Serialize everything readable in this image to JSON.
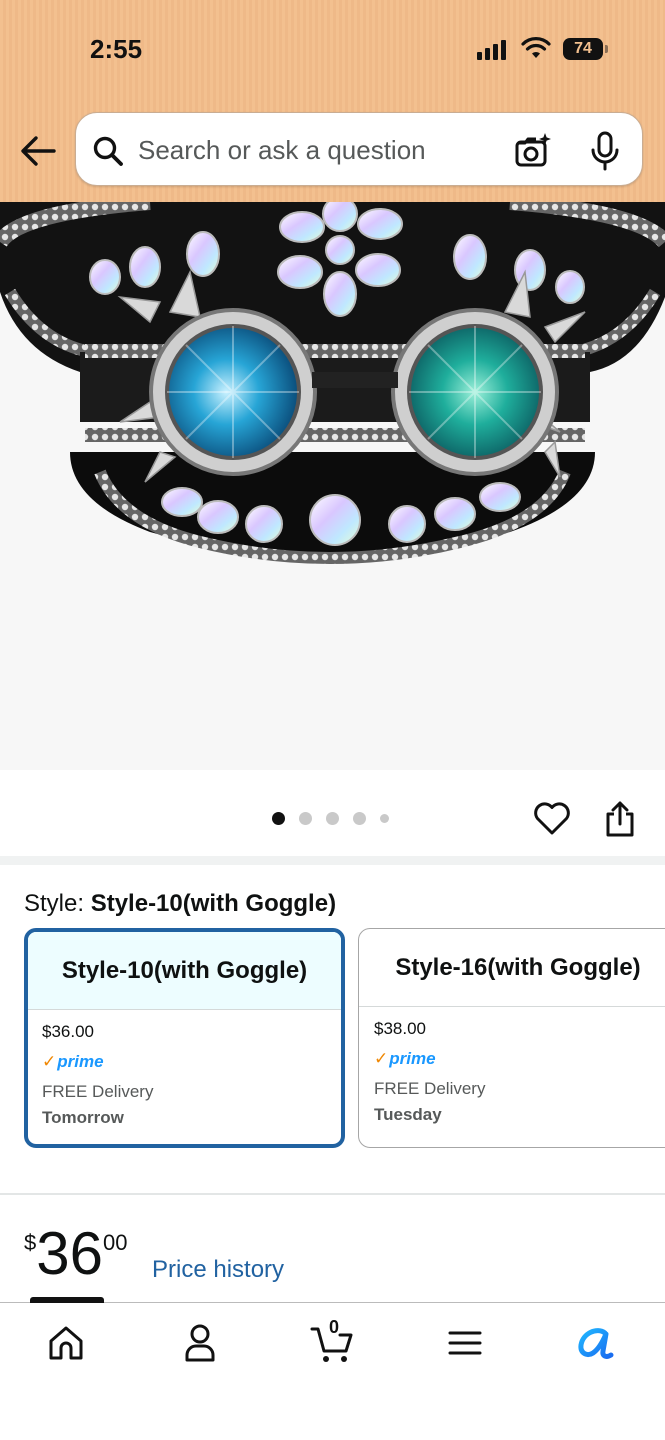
{
  "status_bar": {
    "time": "2:55",
    "battery": "74"
  },
  "search": {
    "placeholder": "Search or ask a question"
  },
  "icons": {
    "back": "arrow-left-icon",
    "search": "search-icon",
    "camera": "camera-icon",
    "mic": "microphone-icon",
    "heart": "heart-icon",
    "share": "share-icon",
    "home": "home-icon",
    "account": "person-icon",
    "cart": "cart-icon",
    "menu": "menu-icon",
    "assistant": "assistant-icon"
  },
  "product": {
    "image_count": 5,
    "active_image": 1
  },
  "style": {
    "label": "Style:",
    "selected_value": "Style-10(with Goggle)",
    "options": [
      {
        "name": "Style-10(with Goggle)",
        "price": "$36.00",
        "prime": "prime",
        "delivery": "FREE Delivery",
        "delivery_day": "Tomorrow"
      },
      {
        "name": "Style-16(with Goggle)",
        "price": "$38.00",
        "prime": "prime",
        "delivery": "FREE Delivery",
        "delivery_day": "Tuesday"
      }
    ]
  },
  "price": {
    "symbol": "$",
    "whole": "36",
    "fraction": "00",
    "history_link": "Price history"
  },
  "nav": {
    "cart_count": "0"
  },
  "colors": {
    "header_bg": "#f3c08f",
    "link_blue": "#2162a1",
    "prime_blue": "#1a98ff",
    "prime_check": "#f08804",
    "selected_border": "#2162a1"
  }
}
